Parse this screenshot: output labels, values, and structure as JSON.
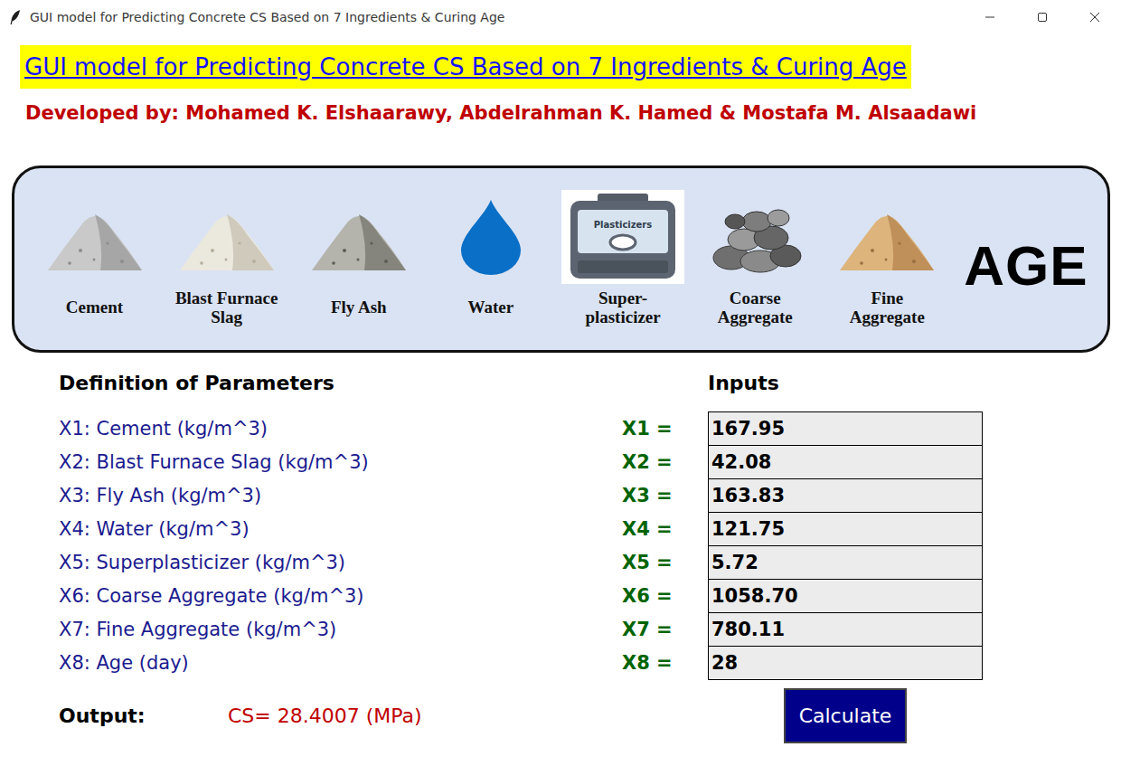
{
  "window": {
    "title": "GUI model for Predicting Concrete CS Based on 7 Ingredients & Curing Age"
  },
  "header": {
    "title": "GUI model for Predicting Concrete CS Based on 7 Ingredients & Curing Age",
    "developers": "Developed by: Mohamed K. Elshaarawy, Abdelrahman K. Hamed & Mostafa M. Alsaadawi"
  },
  "ingredients": [
    {
      "kind": "image",
      "lines": [
        "Cement"
      ]
    },
    {
      "kind": "image",
      "lines": [
        "Blast Furnace",
        "Slag"
      ]
    },
    {
      "kind": "image",
      "lines": [
        "Fly Ash"
      ]
    },
    {
      "kind": "image",
      "lines": [
        "Water"
      ]
    },
    {
      "kind": "image",
      "lines": [
        "Super-",
        "plasticizer"
      ],
      "picture_text": "Plasticizers"
    },
    {
      "kind": "image",
      "lines": [
        "Coarse",
        "Aggregate"
      ]
    },
    {
      "kind": "image",
      "lines": [
        "Fine",
        "Aggregate"
      ]
    },
    {
      "kind": "word",
      "lines": [
        "AGE"
      ]
    }
  ],
  "parameters": {
    "heading": "Definition of Parameters",
    "inputs_heading": "Inputs",
    "rows": [
      {
        "definition": "X1: Cement (kg/m^3)",
        "symbol": "X1 =",
        "value": "167.95"
      },
      {
        "definition": "X2: Blast Furnace Slag (kg/m^3)",
        "symbol": "X2 =",
        "value": "42.08"
      },
      {
        "definition": "X3: Fly Ash (kg/m^3)",
        "symbol": "X3 =",
        "value": "163.83"
      },
      {
        "definition": "X4: Water (kg/m^3)",
        "symbol": "X4 =",
        "value": "121.75"
      },
      {
        "definition": "X5: Superplasticizer (kg/m^3)",
        "symbol": "X5 =",
        "value": "5.72"
      },
      {
        "definition": "X6: Coarse Aggregate (kg/m^3)",
        "symbol": "X6 =",
        "value": "1058.70"
      },
      {
        "definition": "X7: Fine Aggregate (kg/m^3)",
        "symbol": "X7 =",
        "value": "780.11"
      },
      {
        "definition": "X8: Age (day)",
        "symbol": "X8 =",
        "value": "28"
      }
    ]
  },
  "output": {
    "label": "Output:",
    "result": "CS= 28.4007 (MPa)"
  },
  "buttons": [
    "Calculate"
  ]
}
